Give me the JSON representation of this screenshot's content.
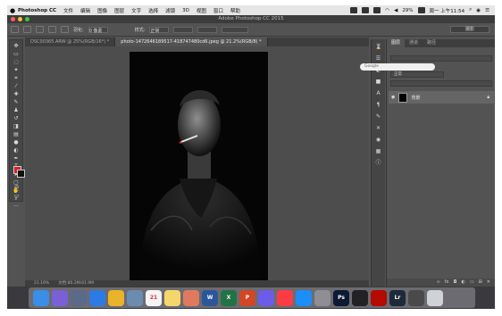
{
  "menubar": {
    "apple_icon": "apple-icon",
    "app_name": "Photoshop CC",
    "items": [
      "文件",
      "编辑",
      "图像",
      "图层",
      "文字",
      "选择",
      "滤镜",
      "3D",
      "视图",
      "窗口",
      "帮助"
    ],
    "battery": "29%",
    "clock": "周一 上午11:54"
  },
  "window": {
    "title": "Adobe Photoshop CC 2015"
  },
  "options": {
    "feather_label": "羽化:",
    "feather_value": "0 像素",
    "style_label": "样式:",
    "style_value": "正常",
    "workspace": "摄影"
  },
  "doc_tabs": [
    {
      "label": "DSC00365.ARW @ 25%(RGB/16*) *",
      "active": false
    },
    {
      "label": "photo-1472646189517-418747480cd6.jpeg @ 21.2%(RGB/8) *",
      "active": true
    }
  ],
  "status": {
    "zoom": "21.19%",
    "doc": "文档:80.2M/41.9M"
  },
  "right_panel": {
    "tabs": [
      "图层",
      "通道",
      "路径"
    ],
    "search_placeholder": "Google",
    "mode": "正常",
    "layer_name": "背景"
  },
  "colors": {
    "foreground": "#d4262b",
    "background": "#111111"
  },
  "dock_apps": [
    {
      "name": "finder",
      "label": "",
      "color": "#3a8ee6"
    },
    {
      "name": "siri",
      "label": "",
      "color": "#7b5fd6"
    },
    {
      "name": "launchpad",
      "label": "",
      "color": "#5a6a88"
    },
    {
      "name": "safari",
      "label": "",
      "color": "#2c7be5"
    },
    {
      "name": "chrome",
      "label": "",
      "color": "#e9b32a"
    },
    {
      "name": "preview",
      "label": "",
      "color": "#6a8caf"
    },
    {
      "name": "calendar",
      "label": "21",
      "color": "#f4f4f4"
    },
    {
      "name": "notes",
      "label": "",
      "color": "#f5d66b"
    },
    {
      "name": "photos",
      "label": "",
      "color": "#e07a5f"
    },
    {
      "name": "word",
      "label": "W",
      "color": "#2b579a"
    },
    {
      "name": "excel",
      "label": "X",
      "color": "#217346"
    },
    {
      "name": "powerpoint",
      "label": "P",
      "color": "#d24726"
    },
    {
      "name": "videos",
      "label": "",
      "color": "#6c5ce7"
    },
    {
      "name": "music",
      "label": "",
      "color": "#fc3c44"
    },
    {
      "name": "appstore",
      "label": "",
      "color": "#1c8ef9"
    },
    {
      "name": "settings",
      "label": "",
      "color": "#8e8e93"
    },
    {
      "name": "photoshop",
      "label": "Ps",
      "color": "#0c1a33"
    },
    {
      "name": "terminal",
      "label": "",
      "color": "#222222"
    },
    {
      "name": "acrobat",
      "label": "",
      "color": "#b30b00"
    },
    {
      "name": "lightroom",
      "label": "Lr",
      "color": "#1c2a3a"
    },
    {
      "name": "finder-window",
      "label": "",
      "color": "#4a4a4a"
    },
    {
      "name": "trash",
      "label": "",
      "color": "#cfd2d6"
    }
  ]
}
